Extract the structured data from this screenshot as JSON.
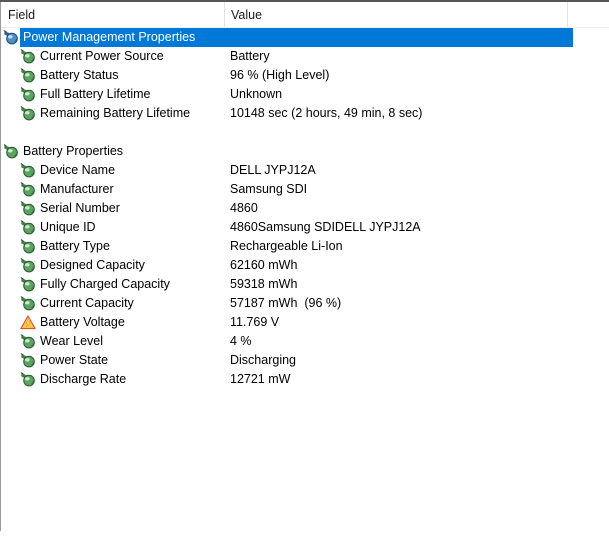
{
  "colors": {
    "selection": "#0078d7",
    "row_text": "#000000",
    "selected_text": "#ffffff",
    "warning_fill": "#fcc63e",
    "warning_border": "#dd4f3b",
    "property_icon_green": "#5ca463",
    "section_icon_blue": "#4d8fc4"
  },
  "header": {
    "field_label": "Field",
    "value_label": "Value"
  },
  "rows": [
    {
      "kind": "section",
      "icon": "power-section-icon",
      "label": "Power Management Properties",
      "value": "",
      "selected": true
    },
    {
      "kind": "item",
      "icon": "property-icon",
      "label": "Current Power Source",
      "value": "Battery"
    },
    {
      "kind": "item",
      "icon": "property-icon",
      "label": "Battery Status",
      "value": "96 % (High Level)"
    },
    {
      "kind": "item",
      "icon": "property-icon",
      "label": "Full Battery Lifetime",
      "value": "Unknown"
    },
    {
      "kind": "item",
      "icon": "property-icon",
      "label": "Remaining Battery Lifetime",
      "value": "10148 sec (2 hours, 49 min, 8 sec)"
    },
    {
      "kind": "spacer"
    },
    {
      "kind": "section",
      "icon": "battery-section-icon",
      "label": "Battery Properties",
      "value": ""
    },
    {
      "kind": "item",
      "icon": "property-icon",
      "label": "Device Name",
      "value": "DELL JYPJ12A"
    },
    {
      "kind": "item",
      "icon": "property-icon",
      "label": "Manufacturer",
      "value": "Samsung SDI"
    },
    {
      "kind": "item",
      "icon": "property-icon",
      "label": "Serial Number",
      "value": "4860"
    },
    {
      "kind": "item",
      "icon": "property-icon",
      "label": "Unique ID",
      "value": "4860Samsung SDIDELL JYPJ12A"
    },
    {
      "kind": "item",
      "icon": "property-icon",
      "label": "Battery Type",
      "value": "Rechargeable Li-Ion"
    },
    {
      "kind": "item",
      "icon": "property-icon",
      "label": "Designed Capacity",
      "value": "62160 mWh"
    },
    {
      "kind": "item",
      "icon": "property-icon",
      "label": "Fully Charged Capacity",
      "value": "59318 mWh"
    },
    {
      "kind": "item",
      "icon": "property-icon",
      "label": "Current Capacity",
      "value": "57187 mWh  (96 %)"
    },
    {
      "kind": "item",
      "icon": "warning-icon",
      "label": "Battery Voltage",
      "value": "11.769 V"
    },
    {
      "kind": "item",
      "icon": "property-icon",
      "label": "Wear Level",
      "value": "4 %"
    },
    {
      "kind": "item",
      "icon": "property-icon",
      "label": "Power State",
      "value": "Discharging"
    },
    {
      "kind": "item",
      "icon": "property-icon",
      "label": "Discharge Rate",
      "value": "12721 mW"
    }
  ]
}
